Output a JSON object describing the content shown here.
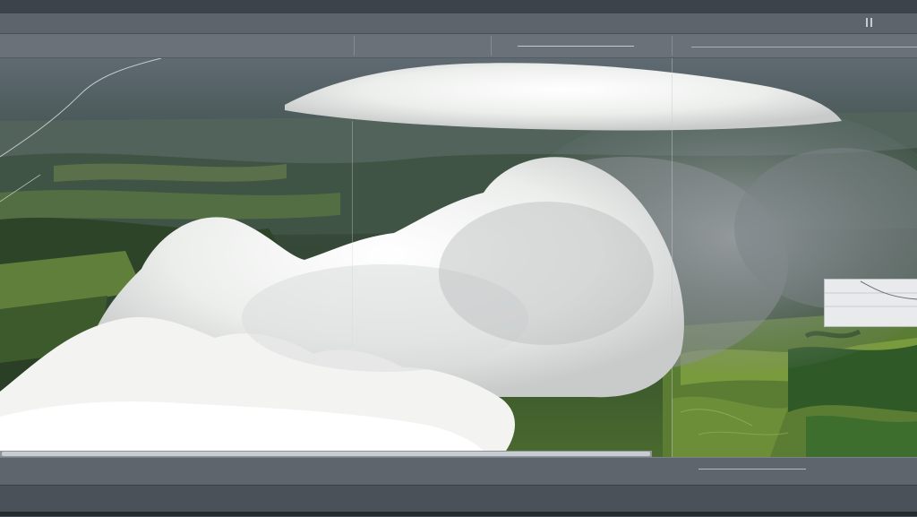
{
  "menu": {
    "items": [
      "",
      "",
      "",
      ""
    ],
    "center_glyph": ""
  },
  "toolbar": {
    "left_label": "",
    "mid_label": "",
    "right_labels": [
      "",
      "",
      "",
      ""
    ]
  },
  "viewport": {
    "labels": {
      "top_left": "",
      "top_left_sub": "",
      "col_a": "",
      "col_b": ""
    }
  },
  "status": {
    "items": [
      "",
      "",
      "",
      "",
      ""
    ]
  },
  "footer": {
    "left_value": "",
    "left_label": "",
    "right_text": ""
  },
  "colors": {
    "chrome": "#4a5158",
    "menu": "#5d646b",
    "toolbar": "#6a7178",
    "cloud": "#f2f2f0",
    "forest": "#2f4530",
    "meadow": "#6a8a34"
  }
}
